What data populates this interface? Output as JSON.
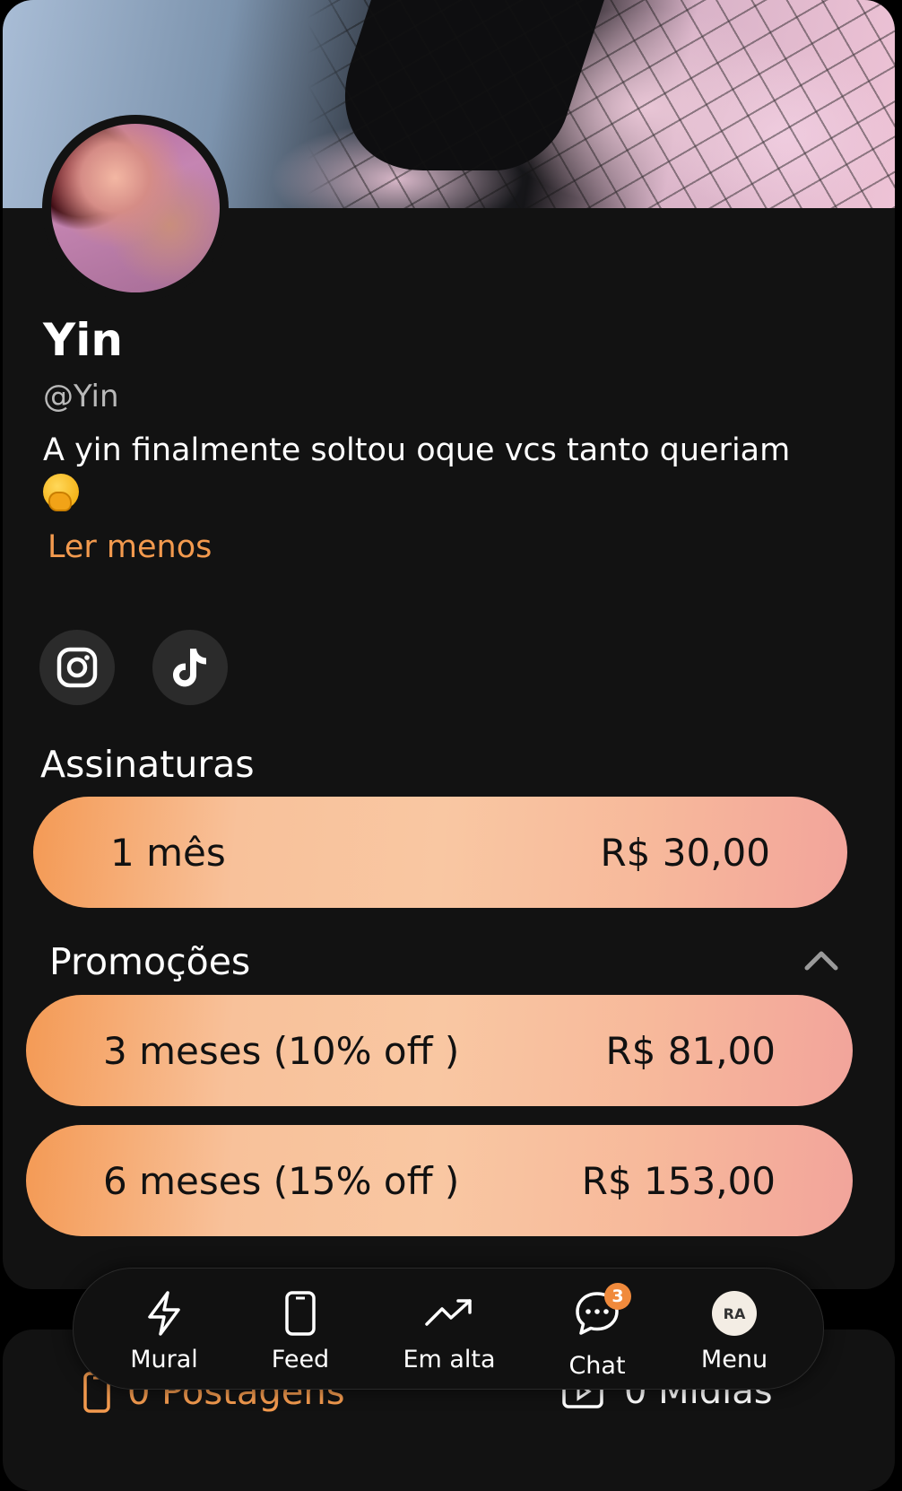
{
  "profile": {
    "name": "Yin",
    "handle": "@Yin",
    "bio": "A yin finalmente soltou oque vcs tanto queriam",
    "bio_emoji": "face-with-hand-over-mouth-emoji",
    "read_less": "Ler menos"
  },
  "social_links": [
    {
      "icon": "instagram-icon"
    },
    {
      "icon": "tiktok-icon"
    }
  ],
  "subscriptions": {
    "title": "Assinaturas",
    "plans": [
      {
        "label": "1 mês",
        "price": "R$ 30,00"
      }
    ]
  },
  "promotions": {
    "title": "Promoções",
    "expanded": true,
    "plans": [
      {
        "label": "3 meses (10% off )",
        "price": "R$ 81,00"
      },
      {
        "label": "6 meses (15% off )",
        "price": "R$ 153,00"
      }
    ]
  },
  "stats": {
    "posts": "0 Postagens",
    "medias": "0 Mídias"
  },
  "bottom_nav": {
    "items": [
      {
        "label": "Mural",
        "icon": "lightning-icon"
      },
      {
        "label": "Feed",
        "icon": "phone-icon"
      },
      {
        "label": "Em alta",
        "icon": "trending-icon"
      },
      {
        "label": "Chat",
        "icon": "chat-icon",
        "badge": "3"
      },
      {
        "label": "Menu",
        "avatar_initials": "RA"
      }
    ]
  },
  "colors": {
    "accent": "#f39a4e",
    "background": "#121212",
    "plan_gradient_start": "#f49a55",
    "plan_gradient_end": "#f2a49b"
  }
}
